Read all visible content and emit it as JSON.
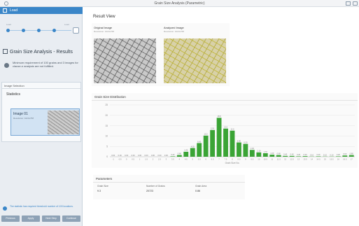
{
  "window": {
    "title": "Grain Size Analysis (Parametric)"
  },
  "sidebar": {
    "header_label": "Load",
    "steps": [
      {
        "label": "Load"
      },
      {
        "label": ""
      },
      {
        "label": ""
      },
      {
        "label": ""
      },
      {
        "label": "Load"
      }
    ],
    "section_title": "Grain Size Analysis - Results",
    "warning_text": "Minimum requirement of 100 grains and 3 images for clause-n analysis are not fulfilled.",
    "image_selection": {
      "header": "Image Selection",
      "statistics_label": "Statistics",
      "image_card": {
        "name": "Image 01",
        "subtitle": "Resolution: 1024x768"
      }
    },
    "info_text": "The statistic has required threshold number of 100 locations.",
    "buttons": [
      {
        "label": "Previous"
      },
      {
        "label": "Apply"
      },
      {
        "label": "Next Step"
      },
      {
        "label": "Continue"
      }
    ]
  },
  "main": {
    "title": "Result View",
    "original": {
      "label": "Original Image",
      "subtitle": "Resolution: 1024x768"
    },
    "analyzed": {
      "label": "Analyzed Image",
      "subtitle": "Resolution: 1024x768"
    },
    "distribution_label": "Grain Size Distribution",
    "parameters": {
      "label": "Parameters",
      "items": [
        {
          "key": "Grain Size",
          "value": "9.3"
        },
        {
          "key": "Number of Grains",
          "value": "20723"
        },
        {
          "key": "Grain Area",
          "value": "0.86"
        }
      ]
    }
  },
  "chart_data": {
    "type": "bar",
    "title": "",
    "xlabel": "Grain Size No.",
    "ylabel": "",
    "ylim": [
      0,
      25
    ],
    "yticks": [
      0,
      5,
      10,
      15,
      20,
      25
    ],
    "categories": [
      "-1",
      "-0.5",
      "0",
      "0.5",
      "1",
      "1.5",
      "2",
      "2.5",
      "3",
      "3.5",
      "4",
      "4.5",
      "5",
      "5.5",
      "6",
      "6.5",
      "7",
      "7.5",
      "8",
      "8.5",
      "9",
      "9.5",
      "10",
      "10.5",
      "11",
      "11.5",
      "12",
      "12.5",
      "13",
      "13.5",
      "14",
      "14.5",
      "15",
      "15.5",
      "16",
      "16.5",
      "17"
    ],
    "values": [
      0,
      0,
      0,
      0,
      0,
      0,
      0,
      0,
      0,
      0.2,
      0.8,
      2.4,
      4.2,
      6.6,
      10.2,
      12.9,
      18.8,
      13.6,
      12.6,
      6.9,
      6.2,
      3.3,
      2.1,
      1.7,
      1.0,
      0.8,
      0.4,
      0.4,
      0.2,
      0.3,
      0.1,
      0.2,
      0.1,
      0.1,
      0.2,
      0.6,
      0.8
    ],
    "value_labels": [
      "0.00",
      "0.00",
      "0.00",
      "0.00",
      "0.00",
      "0.00",
      "0.00",
      "0.00",
      "0.00",
      "0.20",
      "0.80",
      "2.40",
      "4.20",
      "6.60",
      "10.2",
      "12.9",
      "18.8",
      "13.6",
      "12.6",
      "6.90",
      "6.20",
      "3.30",
      "2.10",
      "1.70",
      "1.00",
      "0.80",
      "0.40",
      "0.40",
      "0.20",
      "0.30",
      "0.10",
      "0.20",
      "0.10",
      "0.10",
      "0.20",
      "0.60",
      "0.80"
    ],
    "bar_color": "#3aa435",
    "grid": true
  }
}
